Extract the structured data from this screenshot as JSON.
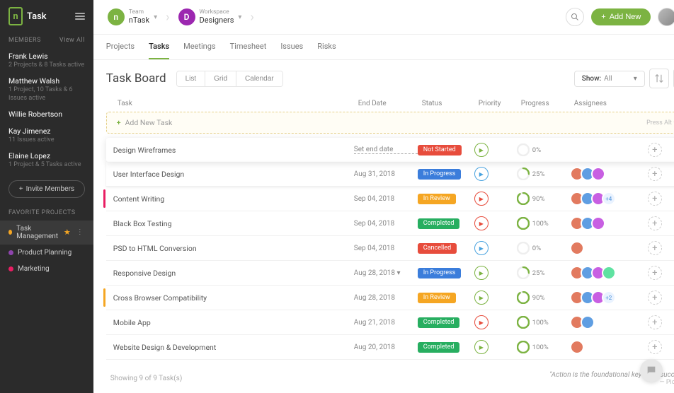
{
  "brand": "Task",
  "sidebar": {
    "members_label": "MEMBERS",
    "view_all": "View All",
    "members": [
      {
        "name": "Frank Lewis",
        "sub": "2 Projects & 8 Tasks active"
      },
      {
        "name": "Matthew Walsh",
        "sub": "1 Project, 10 Tasks & 6 Issues active"
      },
      {
        "name": "Willie Robertson",
        "sub": ""
      },
      {
        "name": "Kay Jimenez",
        "sub": "11 Issues active"
      },
      {
        "name": "Elaine Lopez",
        "sub": "1 Project & 5 Tasks active"
      }
    ],
    "invite_label": "Invite Members",
    "fav_label": "FAVORITE PROJECTS",
    "projects": [
      {
        "name": "Task Management",
        "color": "#f5a623",
        "active": true,
        "starred": true
      },
      {
        "name": "Product Planning",
        "color": "#8e44ad",
        "active": false
      },
      {
        "name": "Marketing",
        "color": "#e91e63",
        "active": false
      }
    ]
  },
  "header": {
    "team_label": "Team",
    "team_name": "nTask",
    "team_color": "#7cb342",
    "team_initial": "n",
    "workspace_label": "Workspace",
    "workspace_name": "Designers",
    "workspace_color": "#9c27b0",
    "workspace_initial": "D",
    "add_new": "Add New"
  },
  "tabs": [
    "Projects",
    "Tasks",
    "Meetings",
    "Timesheet",
    "Issues",
    "Risks"
  ],
  "active_tab": 1,
  "board": {
    "title": "Task Board",
    "views": [
      "List",
      "Grid",
      "Calendar"
    ],
    "show_label": "Show:",
    "show_value": "All"
  },
  "columns": [
    "Task",
    "End Date",
    "Status",
    "Priority",
    "Progress",
    "Assignees"
  ],
  "addrow": {
    "label": "Add New Task",
    "hint": "Press Alt + T"
  },
  "status_colors": {
    "Not Started": "#e74c3c",
    "In Progress": "#3b7ddb",
    "In Review": "#f5a623",
    "Completed": "#27ae60",
    "Cancelled": "#e74c3c"
  },
  "tasks": [
    {
      "name": "Design Wireframes",
      "date": "Set end date",
      "date_dashed": true,
      "status": "Not Started",
      "play": "green",
      "progress": 0,
      "assignees": 0,
      "elev": "elevated"
    },
    {
      "name": "User Interface Design",
      "date": "Aug 31, 2018",
      "status": "In Progress",
      "play": "blue",
      "progress": 25,
      "assignees": 3,
      "elev": "shadowed"
    },
    {
      "name": "Content Writing",
      "date": "Sep 04, 2018",
      "status": "In Review",
      "play": "red",
      "progress": 90,
      "assignees": 3,
      "more": 4,
      "accent": "#e91e63"
    },
    {
      "name": "Black Box Testing",
      "date": "Sep 04, 2018",
      "status": "Completed",
      "play": "red",
      "progress": 100,
      "assignees": 3
    },
    {
      "name": "PSD to HTML Conversion",
      "date": "Sep 04, 2018",
      "status": "Cancelled",
      "play": "blue",
      "progress": 0,
      "assignees": 1
    },
    {
      "name": "Responsive Design",
      "date": "Aug 28, 2018 ▾",
      "status": "In Progress",
      "play": "green",
      "progress": 25,
      "assignees": 4
    },
    {
      "name": "Cross Browser Compatibility",
      "date": "Aug 28, 2018",
      "status": "In Review",
      "play": "green",
      "progress": 90,
      "assignees": 3,
      "more": 2,
      "accent": "#f5a623"
    },
    {
      "name": "Mobile App",
      "date": "Aug 21, 2018",
      "status": "Completed",
      "play": "red",
      "progress": 100,
      "assignees": 2
    },
    {
      "name": "Website Design & Development",
      "date": "Aug 20, 2018",
      "status": "Completed",
      "play": "green",
      "progress": 100,
      "assignees": 1
    }
  ],
  "footer": {
    "count_text": "Showing 9 of 9 Task(s)",
    "quote": "\"Action is the foundational key to all success.\"",
    "author": "— Picasso"
  },
  "avatar_palette": [
    "#e27a5f",
    "#5f9ee2",
    "#c85fe2",
    "#5fe2a1",
    "#e2c85f",
    "#e25f8a",
    "#5fe2dc",
    "#8a5fe2"
  ]
}
